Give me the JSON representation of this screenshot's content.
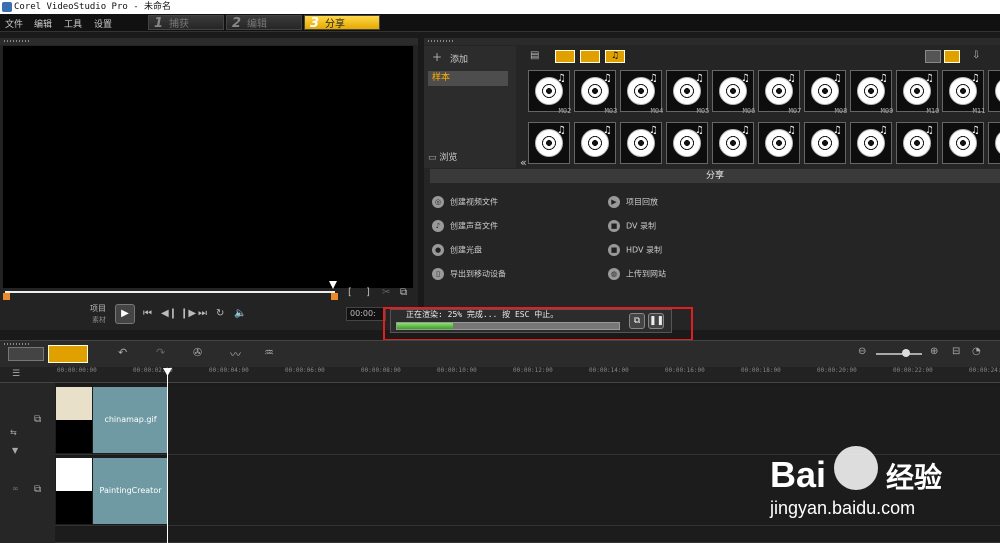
{
  "window": {
    "title": "Corel VideoStudio Pro - 未命名"
  },
  "menu": [
    "文件",
    "编辑",
    "工具",
    "设置"
  ],
  "steps": [
    {
      "num": "1",
      "label": "捕获"
    },
    {
      "num": "2",
      "label": "编辑"
    },
    {
      "num": "3",
      "label": "分享"
    }
  ],
  "library": {
    "add": "添加",
    "sample": "样本",
    "browse": "浏览",
    "tiles": [
      "M02",
      "M03",
      "M04",
      "M05",
      "M06",
      "M07",
      "M08",
      "M09",
      "M10",
      "M11"
    ]
  },
  "share": {
    "header": "分享",
    "left": [
      "创建视频文件",
      "创建声音文件",
      "创建光盘",
      "导出到移动设备"
    ],
    "right": [
      "项目回放",
      "DV 录制",
      "HDV 录制",
      "上传到网站"
    ]
  },
  "preview": {
    "project": "项目",
    "clip": "素材",
    "timecode": "00:00:"
  },
  "render": {
    "status": "正在渲染: 25% 完成... 按 ESC 中止。",
    "progress": 0.25
  },
  "ruler": [
    "00:00:00:00",
    "00:00:02:00",
    "00:00:04:00",
    "00:00:06:00",
    "00:00:08:00",
    "00:00:10:00",
    "00:00:12:00",
    "00:00:14:00",
    "00:00:16:00",
    "00:00:18:00",
    "00:00:20:00",
    "00:00:22:00",
    "00:00:24:00"
  ],
  "clips": [
    "chinamap.gif",
    "PaintingCreator"
  ],
  "watermark": {
    "brand": "Bai",
    "brand2": "经验",
    "url": "jingyan.baidu.com"
  }
}
